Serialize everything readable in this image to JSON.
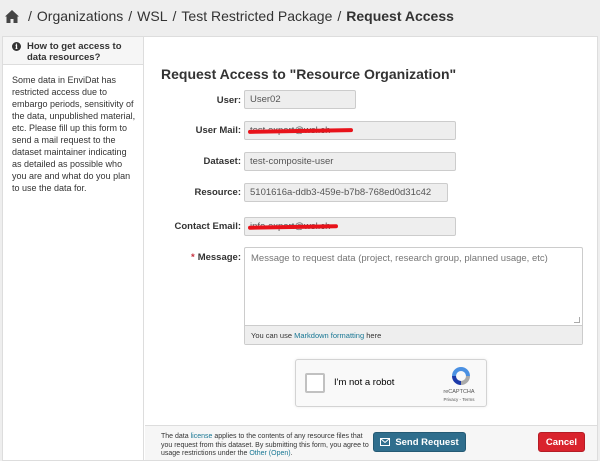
{
  "breadcrumb": {
    "items": [
      "Organizations",
      "WSL",
      "Test Restricted Package"
    ],
    "active": "Request Access",
    "separator": "/"
  },
  "sidebar": {
    "title": "How to get access to data resources?",
    "body": "Some data in EnviDat has restricted access due to embargo periods, sensitivity of the data, unpublished material, etc. Please fill up this form to send a mail request to the dataset maintainer indicating as detailed as possible who you are and what do you plan to use the data for."
  },
  "form": {
    "title": "Request Access to \"Resource Organization\"",
    "fields": [
      {
        "label": "User:",
        "value": "User02"
      },
      {
        "label": "User Mail:",
        "value": "test.expert@wsl.ch"
      },
      {
        "label": "Dataset:",
        "value": "test-composite-user"
      },
      {
        "label": "Resource:",
        "value": "5101616a-ddb3-459e-b7b8-768ed0d31c42"
      },
      {
        "label": "Contact Email:",
        "value": "info.expert@wsl.ch"
      }
    ],
    "message": {
      "required_marker": "*",
      "label": "Message:",
      "placeholder": "Message to request data (project, research group, planned usage, etc)",
      "hint_prefix": "You can use",
      "hint_link": "Markdown formatting",
      "hint_suffix": "here"
    }
  },
  "captcha": {
    "label": "I'm not a robot",
    "brand": "reCAPTCHA",
    "terms": "Privacy - Terms"
  },
  "footer": {
    "note_1": "The data",
    "note_link_1": "license",
    "note_2": "applies to the contents of any resource files that you request from this dataset. By submitting this form, you agree to usage restrictions under the",
    "note_link_2": "Other (Open)",
    "note_3": ".",
    "send_label": "Send Request",
    "cancel_label": "Cancel"
  },
  "colors": {
    "primary": "#2f6e8d",
    "danger": "#d9232d",
    "redaction": "#e8121a",
    "link": "#187794"
  }
}
